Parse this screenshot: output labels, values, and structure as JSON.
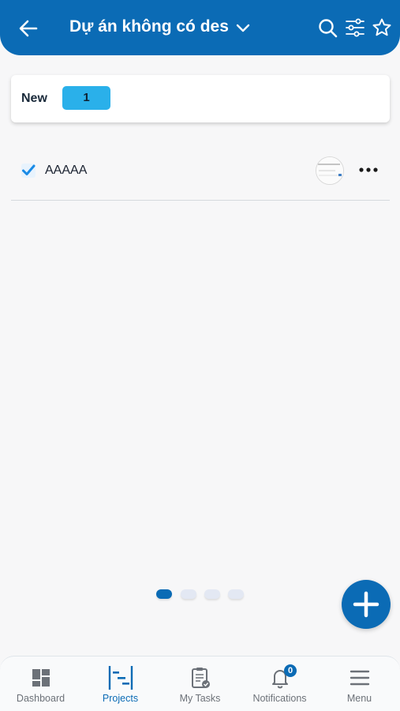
{
  "header": {
    "title": "Dự án không có des",
    "back_icon": "arrow-left-icon",
    "dropdown_icon": "chevron-down-icon",
    "actions": [
      "search-icon",
      "filter-sliders-icon",
      "star-icon"
    ],
    "background_color": "#0b6bb5"
  },
  "status_card": {
    "label": "New",
    "count": "1",
    "count_color": "#2ab0ea"
  },
  "tasks": [
    {
      "name": "AAAAA",
      "checked": true,
      "more_icon": "more-horizontal-icon"
    }
  ],
  "pager": {
    "pages": 4,
    "active_index": 0
  },
  "fab": {
    "icon": "plus-icon"
  },
  "bottom_nav": {
    "items": [
      {
        "label": "Dashboard",
        "icon": "dashboard-icon",
        "active": false
      },
      {
        "label": "Projects",
        "icon": "projects-gantt-icon",
        "active": true
      },
      {
        "label": "My Tasks",
        "icon": "clipboard-tasks-icon",
        "active": false
      },
      {
        "label": "Notifications",
        "icon": "bell-icon",
        "active": false,
        "badge": "0"
      },
      {
        "label": "Menu",
        "icon": "menu-icon",
        "active": false
      }
    ],
    "active_color": "#0b6bb5"
  }
}
